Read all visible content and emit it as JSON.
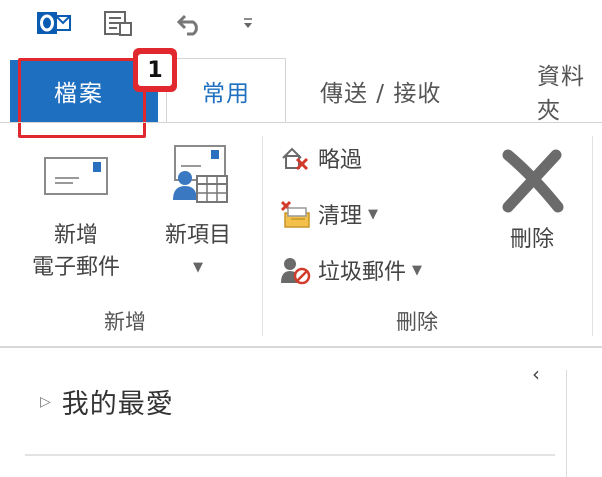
{
  "qat": {
    "outlook_icon": "outlook-logo-icon",
    "sync_icon": "send-receive-all-icon",
    "undo_icon": "undo-icon",
    "customize_icon": "customize-toolbar-icon"
  },
  "tabs": {
    "file": "檔案",
    "home": "常用",
    "send_receive": "傳送 / 接收",
    "folder": "資料夾"
  },
  "callout": {
    "number": "1"
  },
  "ribbon": {
    "new_email_line1": "新增",
    "new_email_line2": "電子郵件",
    "new_items": "新項目",
    "ignore": "略過",
    "cleanup": "清理",
    "junk": "垃圾郵件",
    "delete": "刪除",
    "group_new": "新增",
    "group_delete": "刪除"
  },
  "folder_pane": {
    "favorites": "我的最愛"
  },
  "colors": {
    "accent": "#1e6fc0",
    "highlight": "#e0282e"
  }
}
